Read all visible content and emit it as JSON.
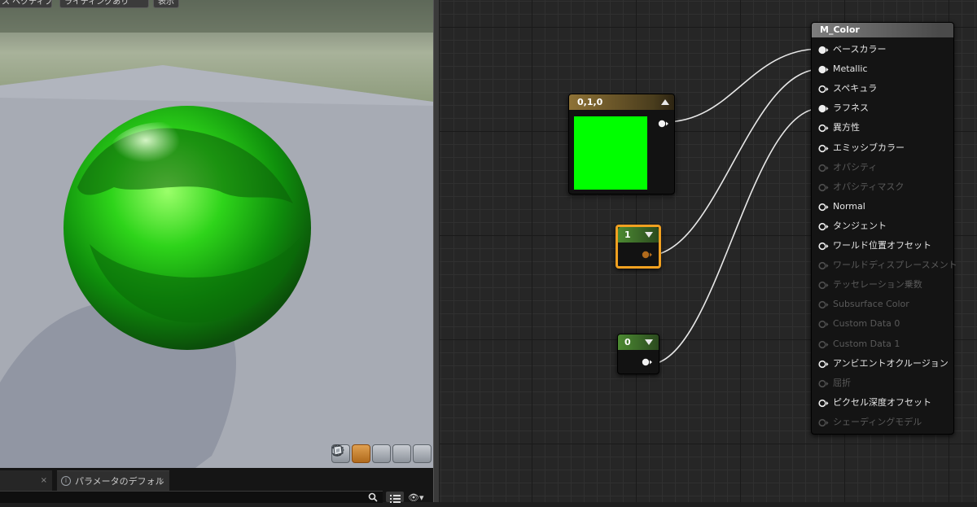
{
  "viewport": {
    "top_buttons": [
      "ス ペクティブ",
      "ライティングあり",
      "表示"
    ],
    "preview_mode_icons": [
      "cylinder-preview-icon",
      "sphere-preview-icon",
      "plane-preview-icon",
      "cube-preview-icon",
      "custom-mesh-preview-icon"
    ],
    "active_preview": "sphere-preview-icon"
  },
  "bottom_panel": {
    "tabs": [
      {
        "label": "",
        "close": "×"
      },
      {
        "label": "パラメータのデフォル",
        "close": "×",
        "icon": "info-icon"
      }
    ],
    "eye_glyph": "👁▾"
  },
  "graph": {
    "color_node": {
      "title": "0,1,0",
      "color": "#00ff00"
    },
    "const_nodes": [
      {
        "title": "1",
        "selected": true
      },
      {
        "title": "0",
        "selected": false
      }
    ],
    "material_node": {
      "title": "M_Color",
      "pins": [
        {
          "label": "ベースカラー",
          "connected": true,
          "enabled": true
        },
        {
          "label": "Metallic",
          "connected": true,
          "enabled": true
        },
        {
          "label": "スペキュラ",
          "connected": false,
          "enabled": true
        },
        {
          "label": "ラフネス",
          "connected": true,
          "enabled": true
        },
        {
          "label": "異方性",
          "connected": false,
          "enabled": true
        },
        {
          "label": "エミッシブカラー",
          "connected": false,
          "enabled": true
        },
        {
          "label": "オパシティ",
          "connected": false,
          "enabled": false
        },
        {
          "label": "オパシティマスク",
          "connected": false,
          "enabled": false
        },
        {
          "label": "Normal",
          "connected": false,
          "enabled": true
        },
        {
          "label": "タンジェント",
          "connected": false,
          "enabled": true
        },
        {
          "label": "ワールド位置オフセット",
          "connected": false,
          "enabled": true
        },
        {
          "label": "ワールドディスプレースメント",
          "connected": false,
          "enabled": false
        },
        {
          "label": "テッセレーション乗数",
          "connected": false,
          "enabled": false
        },
        {
          "label": "Subsurface Color",
          "connected": false,
          "enabled": false
        },
        {
          "label": "Custom Data 0",
          "connected": false,
          "enabled": false
        },
        {
          "label": "Custom Data 1",
          "connected": false,
          "enabled": false
        },
        {
          "label": "アンビエントオクルージョン",
          "connected": false,
          "enabled": true
        },
        {
          "label": "屈折",
          "connected": false,
          "enabled": false
        },
        {
          "label": "ピクセル深度オフセット",
          "connected": false,
          "enabled": true
        },
        {
          "label": "シェーディングモデル",
          "connected": false,
          "enabled": false
        }
      ]
    }
  }
}
